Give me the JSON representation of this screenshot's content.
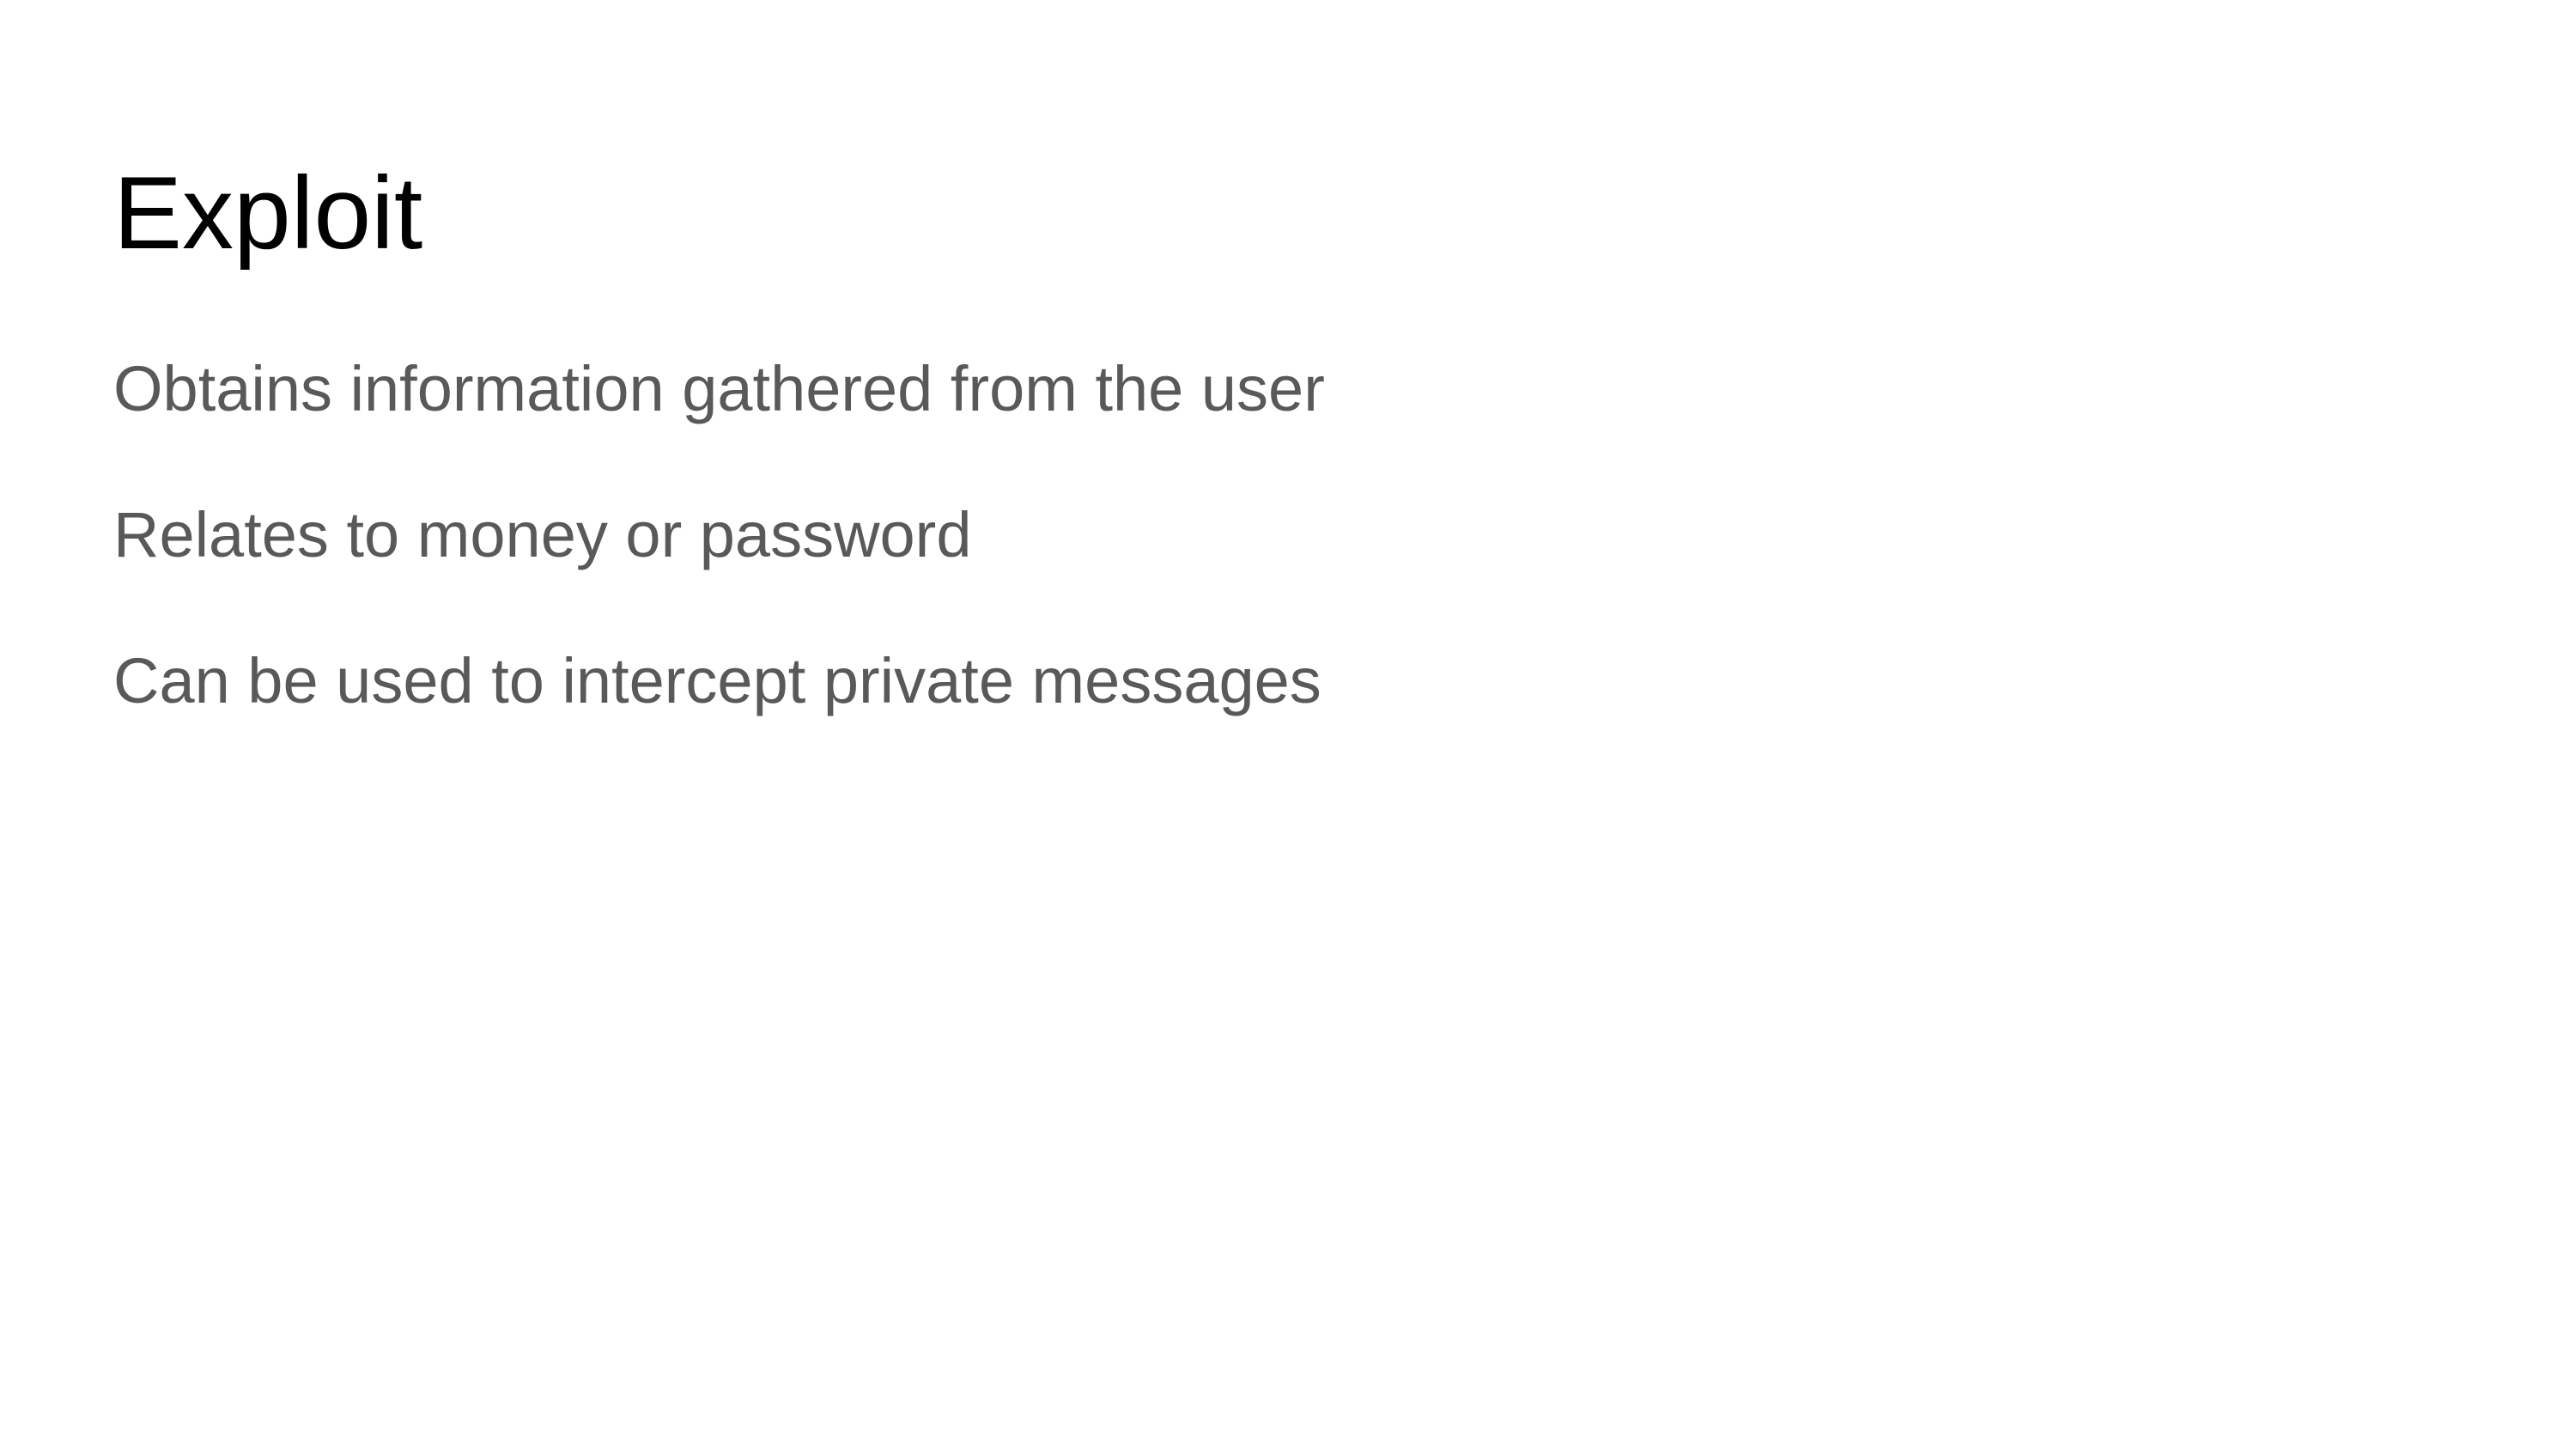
{
  "slide": {
    "title": "Exploit",
    "bullets": [
      "Obtains information gathered from the user",
      "Relates to money or password",
      "Can be used to intercept private messages"
    ]
  },
  "colors": {
    "background": "#ffffff",
    "title": "#000000",
    "body_text": "#595959"
  }
}
